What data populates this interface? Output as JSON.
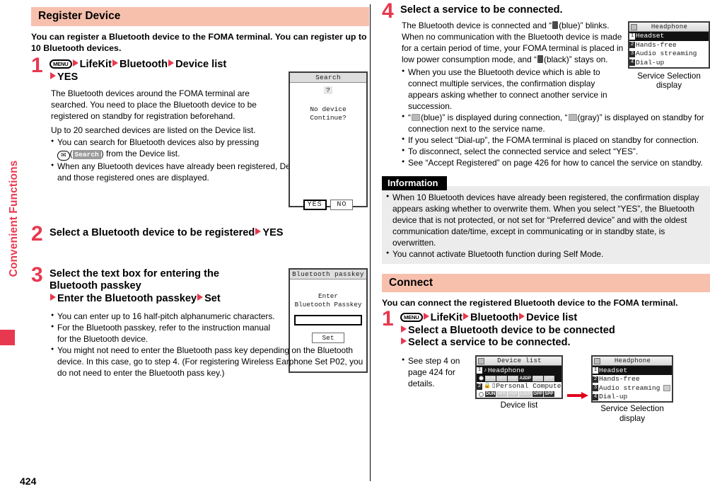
{
  "sidebar": {
    "chapter_label": "Convenient Functions"
  },
  "page_number": "424",
  "left_column": {
    "section_title": "Register Device",
    "intro": "You can register a Bluetooth device to the FOMA terminal. You can register up to 10 Bluetooth devices.",
    "steps": [
      {
        "number": "1",
        "title_parts": [
          "MENU",
          "LifeKit",
          "Bluetooth",
          "Device list",
          "YES"
        ],
        "menu_key": "MENU",
        "title_line1_a": "LifeKit",
        "title_line1_b": "Bluetooth",
        "title_line1_c": "Device list",
        "title_line2": "YES",
        "body": "The Bluetooth devices around the FOMA terminal are searched. You need to place the Bluetooth device to be registered on standby for registration beforehand.",
        "body2": "Up to 20 searched devices are listed on the Device list.",
        "bullets": [
          "You can search for Bluetooth devices also by pressing ( Search ) from the Device list.",
          "When any Bluetooth devices have already been registered, Device list is displayed and those registered ones are displayed."
        ],
        "bullet1_pre": "You can search for Bluetooth devices also by pressing",
        "bullet1_key": "✉",
        "bullet1_btn": "Search",
        "bullet1_post": ") from the Device list.",
        "bullet2": "When any Bluetooth devices have already been registered, Device list is displayed and those registered ones are displayed."
      },
      {
        "number": "2",
        "title": "Select a Bluetooth device to be registered",
        "title_after_arrow": "YES"
      },
      {
        "number": "3",
        "title_line1": "Select the text box for entering the",
        "title_line2": "Bluetooth passkey",
        "title_line3_a": "Enter the Bluetooth passkey",
        "title_line3_b": "Set",
        "bullets": [
          "You can enter up to 16 half-pitch alphanumeric characters.",
          "For the Bluetooth passkey, refer to the instruction manual for the Bluetooth device.",
          "You might not need to enter the Bluetooth pass key depending on the Bluetooth device. In this case, go to step 4. (For registering Wireless Earphone Set P02, you do not need to enter the Bluetooth pass key.)"
        ]
      }
    ],
    "screens": {
      "search_dialog": {
        "title": "Search",
        "question_mark": "?",
        "message_line1": "No device",
        "message_line2": "Continue?",
        "yes_label": "YES",
        "no_label": "NO"
      },
      "passkey_dialog": {
        "title": "Bluetooth passkey",
        "prompt_line1": "Enter",
        "prompt_line2": "Bluetooth Passkey",
        "input_value": "",
        "set_label": "Set"
      }
    }
  },
  "right_column": {
    "step4": {
      "number": "4",
      "title": "Select a service to be connected.",
      "body_a": "The Bluetooth device is connected and “",
      "body_b": "(blue)” blinks. When no communication with the Bluetooth device is made for a certain period of time, your FOMA terminal is placed in low power consumption mode, and “",
      "body_c": "(black)” stays on.",
      "bullets": [
        "When you use the Bluetooth device which is able to connect multiple services, the confirmation display appears asking whether to connect another service in succession.",
        "“ (blue)” is displayed during connection, “ (gray)” is displayed on standby for connection next to the service name.",
        "If you select “Dial-up”, the FOMA terminal is placed on standby for connection.",
        "To disconnect, select the connected service and select “YES”.",
        "See “Accept Registered” on page 426 for how to cancel the service on standby."
      ],
      "bullet2_a": "“",
      "bullet2_b": "(blue)” is displayed during connection, “",
      "bullet2_c": "(gray)” is displayed on standby for connection next to the service name.",
      "bullet3": "If you select “Dial-up”, the FOMA terminal is placed on standby for connection.",
      "bullet4": "To disconnect, select the connected service and select “YES”.",
      "bullet5": "See “Accept Registered” on page 426 for how to cancel the service on standby."
    },
    "information": {
      "heading": "Information",
      "items": [
        "When 10 Bluetooth devices have already been registered, the confirmation display appears asking whether to overwrite them. When you select “YES”, the Bluetooth device that is not protected, or not set for “Preferred device” and with the oldest communication date/time, except in communicating or in standby state, is overwritten.",
        "You cannot activate Bluetooth function during Self Mode."
      ]
    },
    "connect": {
      "section_title": "Connect",
      "intro": "You can connect the registered Bluetooth device to the FOMA terminal.",
      "step": {
        "number": "1",
        "menu_key": "MENU",
        "title_line1_a": "LifeKit",
        "title_line1_b": "Bluetooth",
        "title_line1_c": "Device list",
        "title_line2": "Select a Bluetooth device to be connected",
        "title_line3": "Select a service to be connected.",
        "bullet": "See step 4 on page 424 for details."
      }
    },
    "screens": {
      "service_selection_top": {
        "title": "Headphone",
        "items": [
          {
            "num": "1",
            "label": "Headset",
            "selected": true,
            "standby_icon": false
          },
          {
            "num": "2",
            "label": "Hands-free",
            "selected": false,
            "standby_icon": false
          },
          {
            "num": "3",
            "label": "Audio streaming",
            "selected": false,
            "standby_icon": false
          },
          {
            "num": "4",
            "label": "Dial-up",
            "selected": false,
            "standby_icon": false
          }
        ],
        "caption_line1": "Service Selection",
        "caption_line2": "display"
      },
      "device_list": {
        "title": "Device list",
        "items": [
          {
            "num": "1",
            "label": "Headphone",
            "selected": true,
            "locked": false,
            "type_icon": "headphone-icon",
            "profiles": [
              {
                "name": "DUN",
                "on": false
              },
              {
                "name": "HFP",
                "on": false
              },
              {
                "name": "HSP",
                "on": false
              },
              {
                "name": "A2DP",
                "on": true
              },
              {
                "name": "OPP",
                "on": false
              },
              {
                "name": "SPP",
                "on": false
              }
            ]
          },
          {
            "num": "2",
            "label": "Personal Computer",
            "selected": false,
            "locked": true,
            "type_icon": "computer-icon",
            "profiles": [
              {
                "name": "DUN",
                "on": true
              },
              {
                "name": "HFP",
                "on": false
              },
              {
                "name": "HSP",
                "on": false
              },
              {
                "name": "A2DP",
                "on": false
              },
              {
                "name": "OPP",
                "on": true
              },
              {
                "name": "SPP",
                "on": true
              }
            ]
          }
        ],
        "caption": "Device list"
      },
      "service_selection_bottom": {
        "title": "Headphone",
        "items": [
          {
            "num": "1",
            "label": "Headset",
            "selected": true,
            "standby_icon": false
          },
          {
            "num": "2",
            "label": "Hands-free",
            "selected": false,
            "standby_icon": false
          },
          {
            "num": "3",
            "label": "Audio streaming",
            "selected": false,
            "standby_icon": true
          },
          {
            "num": "4",
            "label": "Dial-up",
            "selected": false,
            "standby_icon": false
          }
        ],
        "caption_line1": "Service Selection",
        "caption_line2": "display"
      }
    }
  },
  "colors": {
    "accent_red": "#e8384f",
    "heading_bar": "#f7c0ad",
    "info_bg": "#ececec",
    "arrow_red": "#e2001a"
  }
}
